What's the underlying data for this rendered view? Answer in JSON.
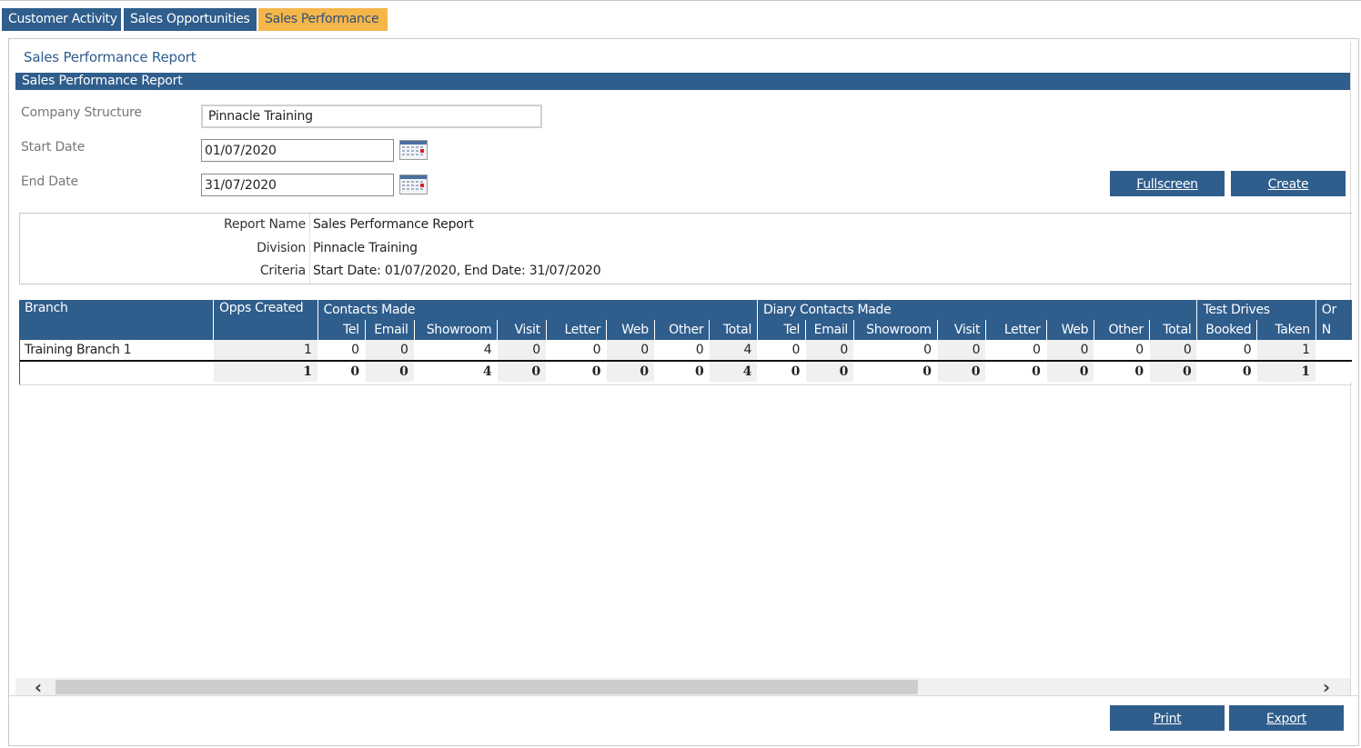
{
  "tabs": [
    {
      "label": "Customer Activity",
      "active": false
    },
    {
      "label": "Sales Opportunities",
      "active": false
    },
    {
      "label": "Sales Performance",
      "active": true
    }
  ],
  "page_title": "Sales Performance Report",
  "section_title": "Sales Performance Report",
  "form": {
    "company_structure_label": "Company Structure",
    "company_structure_value": "Pinnacle Training",
    "start_date_label": "Start Date",
    "start_date_value": "01/07/2020",
    "end_date_label": "End Date",
    "end_date_value": "31/07/2020"
  },
  "buttons": {
    "fullscreen": "Fullscreen",
    "create": "Create",
    "print": "Print",
    "export": "Export"
  },
  "info": {
    "report_name_key": "Report Name",
    "report_name_val": "Sales Performance Report",
    "division_key": "Division",
    "division_val": "Pinnacle Training",
    "criteria_key": "Criteria",
    "criteria_val": "Start Date: 01/07/2020, End Date: 31/07/2020"
  },
  "grid": {
    "branch_header": "Branch",
    "opps_header": "Opps Created",
    "groups": [
      {
        "label": "Contacts Made",
        "cols": [
          "Tel",
          "Email",
          "Showroom",
          "Visit",
          "Letter",
          "Web",
          "Other",
          "Total"
        ]
      },
      {
        "label": "Diary Contacts Made",
        "cols": [
          "Tel",
          "Email",
          "Showroom",
          "Visit",
          "Letter",
          "Web",
          "Other",
          "Total"
        ]
      },
      {
        "label": "Test Drives",
        "cols": [
          "Booked",
          "Taken"
        ]
      },
      {
        "label": "Or",
        "cols": [
          "N"
        ]
      }
    ],
    "rows": [
      {
        "branch": "Training Branch 1",
        "values": [
          "1",
          "0",
          "0",
          "4",
          "0",
          "0",
          "0",
          "0",
          "4",
          "0",
          "0",
          "0",
          "0",
          "0",
          "0",
          "0",
          "0",
          "0",
          "1",
          ""
        ]
      }
    ],
    "totals": {
      "branch": "",
      "values": [
        "1",
        "0",
        "0",
        "4",
        "0",
        "0",
        "0",
        "0",
        "4",
        "0",
        "0",
        "0",
        "0",
        "0",
        "0",
        "0",
        "0",
        "0",
        "1",
        ""
      ]
    }
  },
  "colors": {
    "primary": "#2f5d8c",
    "active_tab": "#f5b649"
  }
}
